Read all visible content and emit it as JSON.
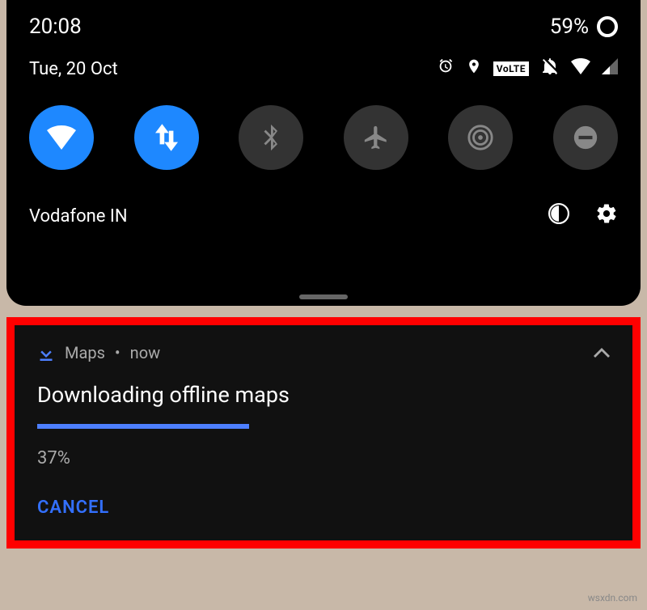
{
  "status": {
    "time": "20:08",
    "battery": "59%"
  },
  "date": "Tue, 20 Oct",
  "volte": "VoLTE",
  "carrier": "Vodafone IN",
  "notification": {
    "app": "Maps",
    "when": "now",
    "title": "Downloading offline maps",
    "progress_pct": "37%",
    "progress_value": 37,
    "cancel_label": "CANCEL"
  },
  "watermark": "wsxdn.com"
}
